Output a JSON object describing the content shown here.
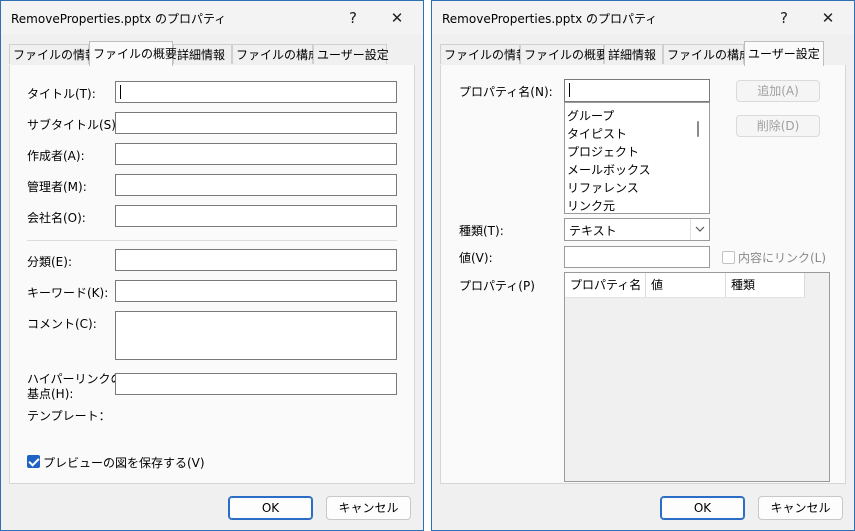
{
  "dialog1": {
    "title": "RemoveProperties.pptx のプロパティ",
    "help": "?",
    "close": "✕",
    "tabs": [
      "ファイルの情報",
      "ファイルの概要",
      "詳細情報",
      "ファイルの構成",
      "ユーザー設定"
    ],
    "active_tab": "ファイルの概要",
    "labels": {
      "title": "タイトル(T):",
      "subtitle": "サブタイトル(S):",
      "author": "作成者(A):",
      "manager": "管理者(M):",
      "company": "会社名(O):",
      "category": "分類(E):",
      "keywords": "キーワード(K):",
      "comments": "コメント(C):",
      "hyperlink_line1": "ハイパーリンクの",
      "hyperlink_line2": "基点(H):",
      "template": "テンプレート："
    },
    "values": {
      "title": "",
      "subtitle": "",
      "author": "",
      "manager": "",
      "company": "",
      "category": "",
      "keywords": "",
      "comments": "",
      "hyperlink": ""
    },
    "save_preview": {
      "label": "プレビューの図を保存する(V)",
      "checked": true
    },
    "ok": "OK",
    "cancel": "キャンセル"
  },
  "dialog2": {
    "title": "RemoveProperties.pptx のプロパティ",
    "help": "?",
    "close": "✕",
    "tabs": [
      "ファイルの情報",
      "ファイルの概要",
      "詳細情報",
      "ファイルの構成",
      "ユーザー設定"
    ],
    "active_tab": "ユーザー設定",
    "name_label": "プロパティ名(N):",
    "name_value": "",
    "name_options": [
      "グループ",
      "タイピスト",
      "プロジェクト",
      "メールボックス",
      "リファレンス",
      "リンク元"
    ],
    "add": "追加(A)",
    "delete": "削除(D)",
    "type_label": "種類(T):",
    "type_value": "テキスト",
    "value_label": "値(V):",
    "value_value": "",
    "link_content": {
      "label": "内容にリンク(L)",
      "checked": false,
      "enabled": false
    },
    "props_label": "プロパティ(P)",
    "columns": [
      "プロパティ名",
      "値",
      "種類"
    ],
    "rows": [],
    "ok": "OK",
    "cancel": "キャンセル"
  }
}
